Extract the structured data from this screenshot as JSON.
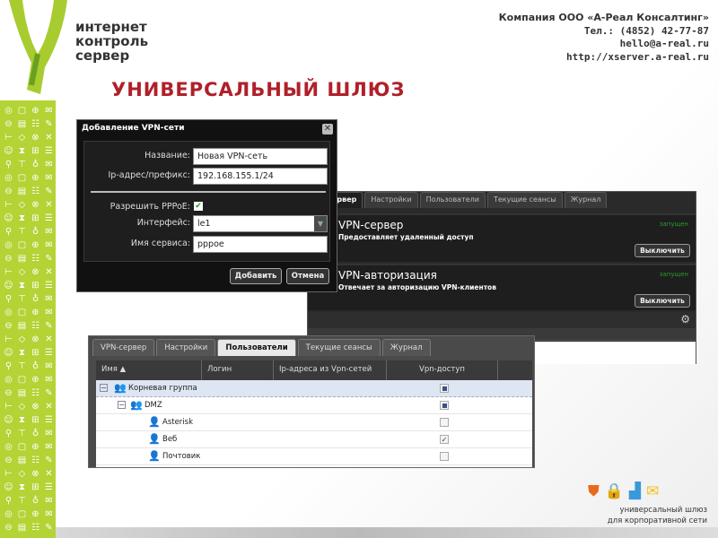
{
  "header": {
    "logo_lines": [
      "интернет",
      "контроль",
      "сервер"
    ],
    "company": [
      "Компания ООО «А-Реал Консалтинг»",
      "Тел.: (4852) 42-77-87",
      "hello@a-real.ru",
      "http://xserver.a-real.ru"
    ],
    "title": "УНИВЕРСАЛЬНЫЙ ШЛЮЗ"
  },
  "dialog": {
    "title": "Добавление VPN-сети",
    "fields": [
      {
        "label": "Название:",
        "value": "Новая VPN-сеть"
      },
      {
        "label": "Ip-адрес/префикс:",
        "value": "192.168.155.1/24"
      },
      {
        "label": "Разрешить PPPoE:",
        "checked": true
      },
      {
        "label": "Интерфейс:",
        "value": "le1"
      },
      {
        "label": "Имя сервиса:",
        "value": "pppoe"
      }
    ],
    "add_label": "Добавить",
    "cancel_label": "Отмена"
  },
  "back_window": {
    "tabs": [
      "ервер",
      "Настройки",
      "Пользователи",
      "Текущие сеансы",
      "Журнал"
    ],
    "services": [
      {
        "name": "VPN-сервер",
        "desc": "Предоставляет удаленный доступ",
        "status": "запущен",
        "button": "Выключить"
      },
      {
        "name": "VPN-авторизация",
        "desc": "Отвечает за авторизацию VPN-клиентов",
        "status": "запущен",
        "button": "Выключить"
      }
    ]
  },
  "front_window": {
    "tabs": [
      "VPN-сервер",
      "Настройки",
      "Пользователи",
      "Текущие сеансы",
      "Журнал"
    ],
    "columns": [
      "Имя ▲",
      "Логин",
      "Ip-адреса из Vpn-сетей",
      "Vpn-доступ"
    ],
    "rows": [
      {
        "name": "Корневая группа",
        "access": "partial"
      },
      {
        "name": "DMZ",
        "access": "partial"
      },
      {
        "name": "Asterisk",
        "access": "none"
      },
      {
        "name": "Веб",
        "access": "checked"
      },
      {
        "name": "Почтовик",
        "access": "none"
      }
    ]
  },
  "footer": {
    "lines": [
      "универсальный шлюз",
      "для корпоративной сети"
    ]
  },
  "colors": {
    "title": "#b0202a",
    "brand_green": "#b4d335",
    "status_green": "#2a9a2a"
  }
}
